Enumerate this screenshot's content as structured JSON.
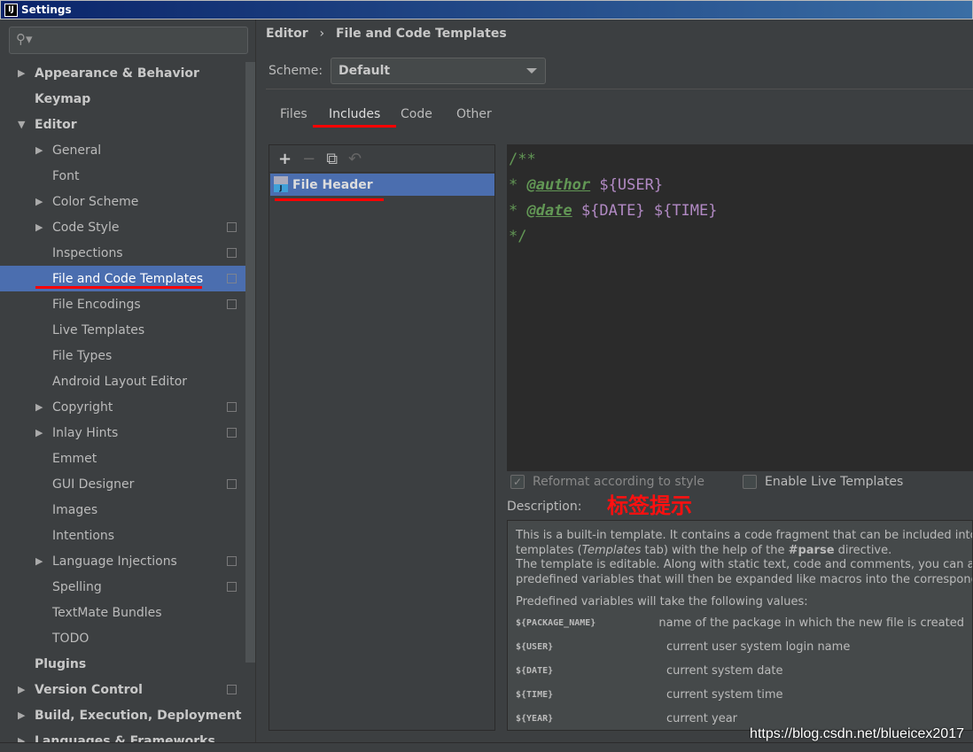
{
  "window": {
    "title": "Settings",
    "icon": "IJ"
  },
  "sidebar": {
    "search_placeholder": "",
    "items": [
      {
        "label": "Appearance & Behavior",
        "level": 0,
        "arrow": "right",
        "bold": true
      },
      {
        "label": "Keymap",
        "level": 0,
        "bold": true
      },
      {
        "label": "Editor",
        "level": 0,
        "arrow": "down",
        "bold": true
      },
      {
        "label": "General",
        "level": 1,
        "arrow": "right"
      },
      {
        "label": "Font",
        "level": 1
      },
      {
        "label": "Color Scheme",
        "level": 1,
        "arrow": "right"
      },
      {
        "label": "Code Style",
        "level": 1,
        "arrow": "right",
        "copy": true
      },
      {
        "label": "Inspections",
        "level": 1,
        "copy": true
      },
      {
        "label": "File and Code Templates",
        "level": 1,
        "copy": true,
        "selected": true
      },
      {
        "label": "File Encodings",
        "level": 1,
        "copy": true
      },
      {
        "label": "Live Templates",
        "level": 1
      },
      {
        "label": "File Types",
        "level": 1
      },
      {
        "label": "Android Layout Editor",
        "level": 1
      },
      {
        "label": "Copyright",
        "level": 1,
        "arrow": "right",
        "copy": true
      },
      {
        "label": "Inlay Hints",
        "level": 1,
        "arrow": "right",
        "copy": true
      },
      {
        "label": "Emmet",
        "level": 1
      },
      {
        "label": "GUI Designer",
        "level": 1,
        "copy": true
      },
      {
        "label": "Images",
        "level": 1
      },
      {
        "label": "Intentions",
        "level": 1
      },
      {
        "label": "Language Injections",
        "level": 1,
        "arrow": "right",
        "copy": true
      },
      {
        "label": "Spelling",
        "level": 1,
        "copy": true
      },
      {
        "label": "TextMate Bundles",
        "level": 1
      },
      {
        "label": "TODO",
        "level": 1
      },
      {
        "label": "Plugins",
        "level": 0,
        "bold": true
      },
      {
        "label": "Version Control",
        "level": 0,
        "arrow": "right",
        "bold": true,
        "copy": true
      },
      {
        "label": "Build, Execution, Deployment",
        "level": 0,
        "arrow": "right",
        "bold": true
      },
      {
        "label": "Languages & Frameworks",
        "level": 0,
        "arrow": "right",
        "bold": true
      }
    ]
  },
  "breadcrumb": {
    "parent": "Editor",
    "separator": "›",
    "current": "File and Code Templates"
  },
  "scheme": {
    "label": "Scheme:",
    "value": "Default"
  },
  "tabs": [
    {
      "label": "Files"
    },
    {
      "label": "Includes",
      "active": true
    },
    {
      "label": "Code"
    },
    {
      "label": "Other"
    }
  ],
  "toolbar": {
    "add": "+",
    "remove": "−",
    "copy": "⧉",
    "reset": "↶"
  },
  "templates": [
    {
      "name": "File Header",
      "icon_letter": "J",
      "selected": true
    }
  ],
  "editor": {
    "line1": "/**",
    "star": "*",
    "author_tag": "@author",
    "user_var": "${USER}",
    "date_tag": "@date",
    "date_var": "${DATE}",
    "time_var": "${TIME}",
    "end": "*/"
  },
  "options": {
    "reformat": {
      "label": "Reformat according to style",
      "checked": true,
      "enabled": false
    },
    "live": {
      "label": "Enable Live Templates",
      "checked": false
    }
  },
  "description": {
    "label": "Description:",
    "annotation": "标签提示",
    "p1a": "This is a built-in template. It contains a code fragment that can be included into file",
    "p1b_pre": "templates (",
    "p1b_em": "Templates",
    "p1b_mid": " tab) with the help of the ",
    "p1b_bold": "#parse",
    "p1b_post": " directive.",
    "p2a": "The template is editable. Along with static text, code and comments, you can also use",
    "p2b": "predefined variables that will then be expanded like macros into the corresponding values.",
    "p3": "Predefined variables will take the following values:",
    "vars": [
      {
        "name": "${PACKAGE_NAME}",
        "desc": "name of the package in which the new file is created"
      },
      {
        "name": "${USER}",
        "desc": "current user system login name"
      },
      {
        "name": "${DATE}",
        "desc": "current system date"
      },
      {
        "name": "${TIME}",
        "desc": "current system time"
      },
      {
        "name": "${YEAR}",
        "desc": "current year"
      }
    ]
  },
  "watermark": "https://blog.csdn.net/blueicex2017",
  "colors": {
    "selection": "#4b6eaf",
    "annotation": "#ff0000",
    "comment": "#629755",
    "variable": "#b28ac4"
  }
}
